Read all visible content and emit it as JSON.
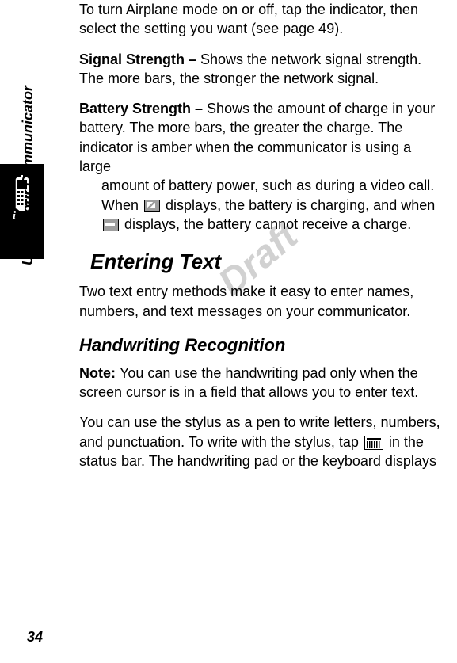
{
  "sideLabel": "Using Your Communicator",
  "pageNumber": "34",
  "watermark": "Draft",
  "para1": "To turn Airplane mode on or off, tap the indicator, then select the setting you want (see page 49).",
  "signal": {
    "label": "Signal Strength – ",
    "text": "Shows the network signal strength. The more bars, the stronger the network signal."
  },
  "battery": {
    "label": "Battery Strength – ",
    "text1": "Shows the amount of charge in your battery. The more bars, the greater the charge. The indicator is amber when the communicator is using a large ",
    "text2": "amount of battery power, such as during a video call. When ",
    "text3": " displays, the battery is charging, and when ",
    "text4": " displays, the battery cannot receive a charge."
  },
  "heading": "Entering Text",
  "entering": "Two text entry methods make it easy to enter names, numbers, and text messages on your communicator.",
  "subheading": "Handwriting Recognition",
  "note": {
    "label": "Note: ",
    "text": "You can use the handwriting pad only when the screen cursor is in a field that allows you to enter text."
  },
  "stylus": {
    "text1": "You can use the stylus as a pen to write letters, numbers, and punctuation. To write with the stylus, tap ",
    "text2": " in the status bar. The handwriting pad or the keyboard displays"
  }
}
